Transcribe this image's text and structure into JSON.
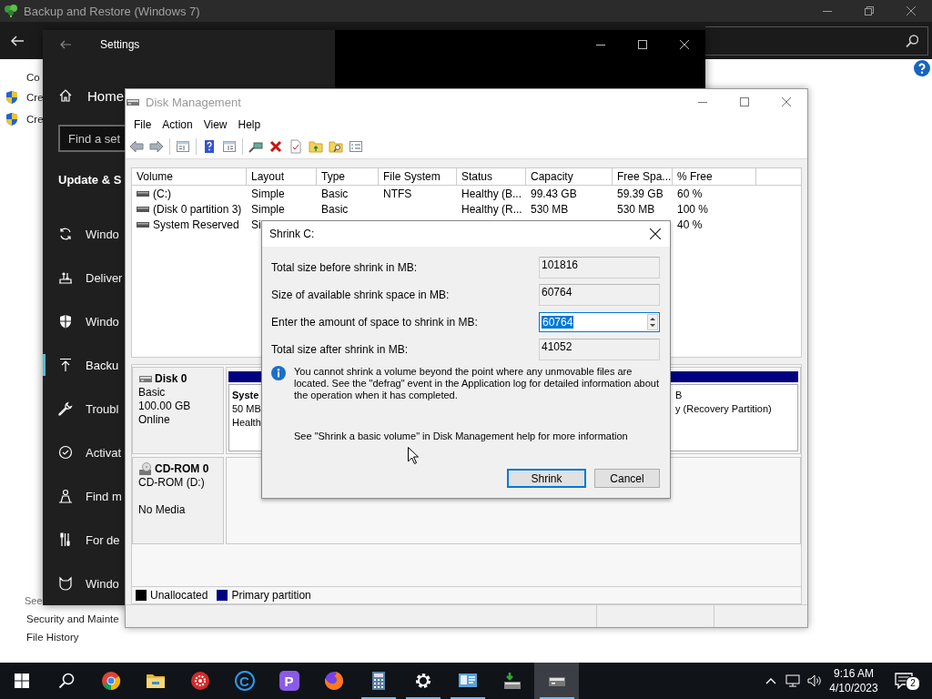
{
  "backup_window": {
    "title": "Backup and Restore (Windows 7)",
    "sidebar_heading": "Co",
    "sidebar_links": [
      "Cre",
      "Cre"
    ],
    "see_also_heading": "See",
    "see_also_links": [
      "Security and Mainte",
      "File History"
    ]
  },
  "settings_window": {
    "title": "Settings",
    "home": "Home",
    "search": {
      "placeholder": "Find a set"
    },
    "section_heading": "Update & S",
    "nav_items": [
      {
        "label": "Windo",
        "selected": false
      },
      {
        "label": "Deliver",
        "selected": false
      },
      {
        "label": "Windo",
        "selected": false
      },
      {
        "label": "Backu",
        "selected": true
      },
      {
        "label": "Troubl",
        "selected": false
      },
      {
        "label": "Activat",
        "selected": false
      },
      {
        "label": "Find m",
        "selected": false
      },
      {
        "label": "For de",
        "selected": false
      },
      {
        "label": "Windo",
        "selected": false
      }
    ]
  },
  "disk_management": {
    "title": "Disk Management",
    "menu": [
      "File",
      "Action",
      "View",
      "Help"
    ],
    "volume_table": {
      "columns": [
        "Volume",
        "Layout",
        "Type",
        "File System",
        "Status",
        "Capacity",
        "Free Spa...",
        "% Free"
      ],
      "rows": [
        {
          "volume": "(C:)",
          "layout": "Simple",
          "type": "Basic",
          "file_system": "NTFS",
          "status": "Healthy (B...",
          "capacity": "99.43 GB",
          "free_space": "59.39 GB",
          "percent_free": "60 %"
        },
        {
          "volume": "(Disk 0 partition 3)",
          "layout": "Simple",
          "type": "Basic",
          "status": "Healthy (R...",
          "capacity": "530 MB",
          "free_space": "530 MB",
          "percent_free": "100 %"
        },
        {
          "volume": "System Reserved",
          "layout": "Si",
          "percent_free": "40 %"
        }
      ]
    },
    "disks": [
      {
        "kind": "disk",
        "name": "Disk 0",
        "type": "Basic",
        "size": "100.00 GB",
        "status": "Online",
        "partitions": [
          {
            "name": "Syste",
            "size": "50 MB",
            "status": "Health"
          },
          {
            "size": "B",
            "status": "y (Recovery Partition)"
          }
        ]
      },
      {
        "kind": "cdrom",
        "name": "CD-ROM 0",
        "type": "CD-ROM (D:)",
        "status": "No Media"
      }
    ],
    "legend": [
      {
        "label": "Unallocated",
        "color": "#000000"
      },
      {
        "label": "Primary partition",
        "color": "#000080"
      }
    ]
  },
  "shrink_dialog": {
    "title": "Shrink C:",
    "fields": [
      {
        "label": "Total size before shrink in MB:",
        "value": "101816",
        "kind": "readonly"
      },
      {
        "label": "Size of available shrink space in MB:",
        "value": "60764",
        "kind": "readonly"
      },
      {
        "label": "Enter the amount of space to shrink in MB:",
        "value": "60764",
        "kind": "spin",
        "text_selected": true
      },
      {
        "label": "Total size after shrink in MB:",
        "value": "41052",
        "kind": "readonly"
      }
    ],
    "info": "You cannot shrink a volume beyond the point where any unmovable files are located. See the \"defrag\" event in the Application log for detailed information about the operation when it has completed.",
    "help_note": "See \"Shrink a basic volume\" in Disk Management help for more information",
    "buttons": [
      {
        "label": "Shrink",
        "default": true
      },
      {
        "label": "Cancel",
        "default": false
      }
    ]
  },
  "taskbar": {
    "apps": [
      {
        "running": false,
        "selected": false
      },
      {
        "running": false,
        "selected": false
      },
      {
        "running": false,
        "selected": false
      },
      {
        "label": "C",
        "running": false,
        "selected": false
      },
      {
        "label": "P",
        "running": false,
        "selected": false
      },
      {
        "running": false,
        "selected": false
      },
      {
        "running": true,
        "selected": false
      },
      {
        "running": true,
        "selected": false
      },
      {
        "running": true,
        "selected": false
      },
      {
        "running": false,
        "selected": false
      },
      {
        "running": true,
        "selected": true
      }
    ],
    "time": "9:16 AM",
    "date": "4/10/2023",
    "notifications": "2"
  }
}
